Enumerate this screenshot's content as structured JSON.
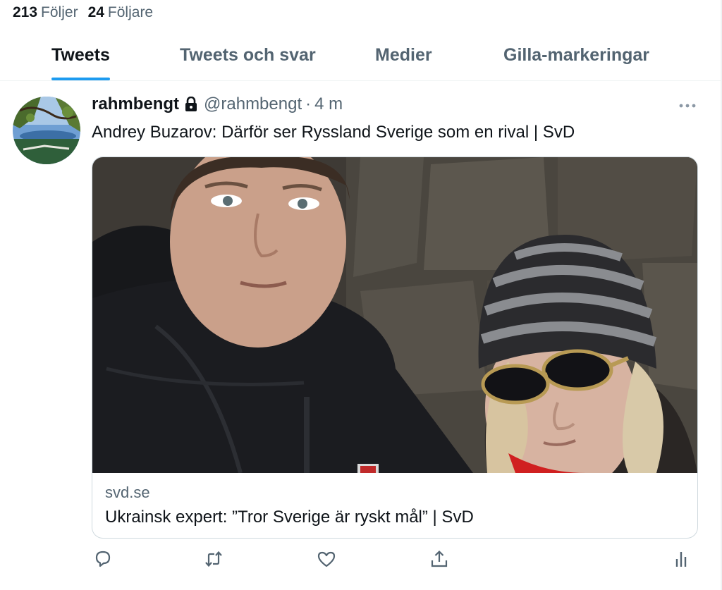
{
  "profile": {
    "following_count": "213",
    "following_label": "Följer",
    "followers_count": "24",
    "followers_label": "Följare"
  },
  "tabs": [
    {
      "label": "Tweets",
      "active": true
    },
    {
      "label": "Tweets och svar",
      "active": false
    },
    {
      "label": "Medier",
      "active": false
    },
    {
      "label": "Gilla-markeringar",
      "active": false
    }
  ],
  "tweet": {
    "display_name": "rahmbengt",
    "handle": "@rahmbengt",
    "separator": "·",
    "time": "4 m",
    "text": "Andrey Buzarov: Därför ser Ryssland Sverige som en rival | SvD",
    "card": {
      "domain": "svd.se",
      "title": "Ukrainsk expert: ”Tror Sverige är ryskt mål” | SvD"
    },
    "actions": [
      "reply-icon",
      "retweet-icon",
      "like-icon",
      "share-icon",
      "analytics-icon"
    ]
  },
  "colors": {
    "accent": "#1d9bf0",
    "text_primary": "#0f1419",
    "text_secondary": "#536471",
    "border": "#cfd9de"
  }
}
